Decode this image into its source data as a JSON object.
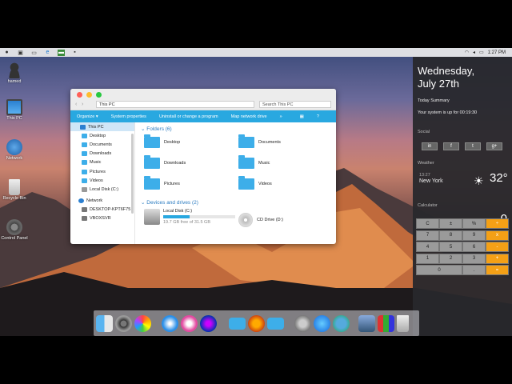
{
  "menubar": {
    "apple": "",
    "clock": "1:27 PM"
  },
  "desktop": {
    "icons": [
      {
        "label": "hamed",
        "icon": "user-icon"
      },
      {
        "label": "This PC",
        "icon": "monitor-icon"
      },
      {
        "label": "Network",
        "icon": "globe-icon"
      },
      {
        "label": "Recycle Bin",
        "icon": "trash-icon"
      },
      {
        "label": "Control Panel",
        "icon": "control-panel-icon"
      }
    ]
  },
  "explorer": {
    "address": "This PC",
    "search_placeholder": "Search This PC",
    "toolbar": {
      "organize": "Organize ▾",
      "system_properties": "System properties",
      "uninstall": "Uninstall or change a program",
      "map_network": "Map network drive",
      "more": "»"
    },
    "sidebar": [
      {
        "label": "This PC",
        "selected": true
      },
      {
        "label": "Desktop",
        "selected": false
      },
      {
        "label": "Documents",
        "selected": false
      },
      {
        "label": "Downloads",
        "selected": false
      },
      {
        "label": "Music",
        "selected": false
      },
      {
        "label": "Pictures",
        "selected": false
      },
      {
        "label": "Videos",
        "selected": false
      },
      {
        "label": "Local Disk (C:)",
        "selected": false
      },
      {
        "label": "Network",
        "selected": false
      },
      {
        "label": "DESKTOP-KPT6F75",
        "selected": false
      },
      {
        "label": "VBOXSVR",
        "selected": false
      }
    ],
    "folders_header": "Folders (6)",
    "folders": [
      "Desktop",
      "Documents",
      "Downloads",
      "Music",
      "Pictures",
      "Videos"
    ],
    "drives_header": "Devices and drives (2)",
    "drives": [
      {
        "label": "Local Disk (C:)",
        "free": "19.7 GB free of 31.5 GB",
        "used_fraction": 0.37
      },
      {
        "label": "CD Drive (D:)"
      }
    ]
  },
  "panel": {
    "weekday": "Wednesday,",
    "date": "July 27th",
    "summary_title": "Today Summary",
    "uptime": "Your system is up for 00:19:30",
    "social_title": "Social",
    "social": [
      "in",
      "f",
      "t",
      "g+"
    ],
    "weather_title": "Weather",
    "weather_time": "13:27",
    "weather_city": "New York",
    "weather_temp": "32°",
    "calculator_title": "Calculator",
    "calc_display": "0",
    "calc_keys": [
      [
        "C",
        "±",
        "%",
        "÷"
      ],
      [
        "7",
        "8",
        "9",
        "x"
      ],
      [
        "4",
        "5",
        "6",
        "-"
      ],
      [
        "1",
        "2",
        "3",
        "+"
      ],
      [
        "0",
        ".",
        "="
      ]
    ]
  },
  "colors": {
    "accent": "#29a8e0",
    "folder": "#3daee9",
    "calc_operator": "#f4a016",
    "panel_bg": "#28282c"
  }
}
